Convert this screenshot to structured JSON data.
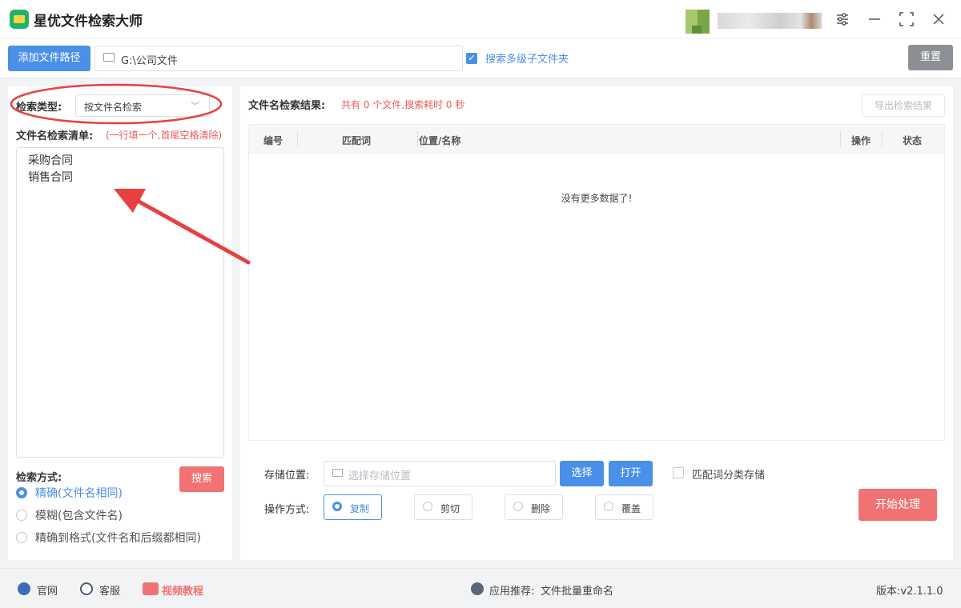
{
  "app": {
    "title": "星优文件检索大师"
  },
  "toolbar": {
    "add_path_label": "添加文件路径",
    "path_value": "G:\\公司文件",
    "subfolder_label": "搜索多级子文件夹",
    "subfolder_checked": true,
    "reset_label": "重置"
  },
  "left": {
    "search_type_label": "检索类型:",
    "search_type_value": "按文件名检索",
    "list_label": "文件名检索清单:",
    "list_hint": "(一行填一个,首尾空格清除)",
    "list_items": [
      "采购合同",
      "销售合同"
    ],
    "mode_label": "检索方式:",
    "search_button": "搜索",
    "modes": [
      {
        "label": "精确(文件名相同)",
        "selected": true
      },
      {
        "label": "模糊(包含文件名)",
        "selected": false
      },
      {
        "label": "精确到格式(文件名和后缀都相同)",
        "selected": false
      }
    ]
  },
  "results": {
    "title": "文件名检索结果:",
    "summary": "共有 0 个文件,搜索耗时 0 秒",
    "export_label": "导出检索结果",
    "columns": [
      "编号",
      "匹配词",
      "位置/名称",
      "操作",
      "状态"
    ],
    "empty_text": "没有更多数据了!"
  },
  "storage": {
    "label": "存储位置:",
    "placeholder": "选择存储位置",
    "select_label": "选择",
    "open_label": "打开",
    "classify_label": "匹配词分类存储"
  },
  "operation": {
    "label": "操作方式:",
    "options": [
      {
        "label": "复制",
        "selected": true
      },
      {
        "label": "剪切",
        "selected": false
      },
      {
        "label": "删除",
        "selected": false
      },
      {
        "label": "覆盖",
        "selected": false
      }
    ],
    "start_label": "开始处理"
  },
  "status": {
    "website": "官网",
    "support": "客服",
    "video": "视频教程",
    "recommend_label": "应用推荐:",
    "recommend_app": "文件批量重命名",
    "version": "版本:v2.1.1.0"
  },
  "colors": {
    "accent": "#4a90e8",
    "danger": "#f07272",
    "annotation": "#e84040"
  }
}
